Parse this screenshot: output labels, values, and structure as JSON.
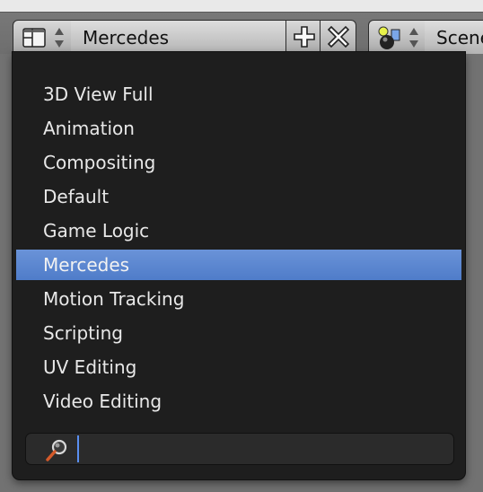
{
  "header": {
    "screen_layout": "Mercedes",
    "scene": "Scene",
    "icons": {
      "layout": "screen-layout-icon",
      "updown": "updown-arrows-icon",
      "add": "plus-icon",
      "delete": "x-icon",
      "scene": "scene-icon"
    }
  },
  "menu": {
    "items": [
      {
        "label": "3D View Full"
      },
      {
        "label": "Animation"
      },
      {
        "label": "Compositing"
      },
      {
        "label": "Default"
      },
      {
        "label": "Game Logic"
      },
      {
        "label": "Mercedes",
        "selected": true
      },
      {
        "label": "Motion Tracking"
      },
      {
        "label": "Scripting"
      },
      {
        "label": "UV Editing"
      },
      {
        "label": "Video Editing"
      }
    ],
    "search": {
      "value": "",
      "icon": "magnifier-icon"
    }
  },
  "colors": {
    "menu_bg": "#1e1e1e",
    "selected_bg": "#5a86d0",
    "menu_text": "#e8e8e8"
  }
}
